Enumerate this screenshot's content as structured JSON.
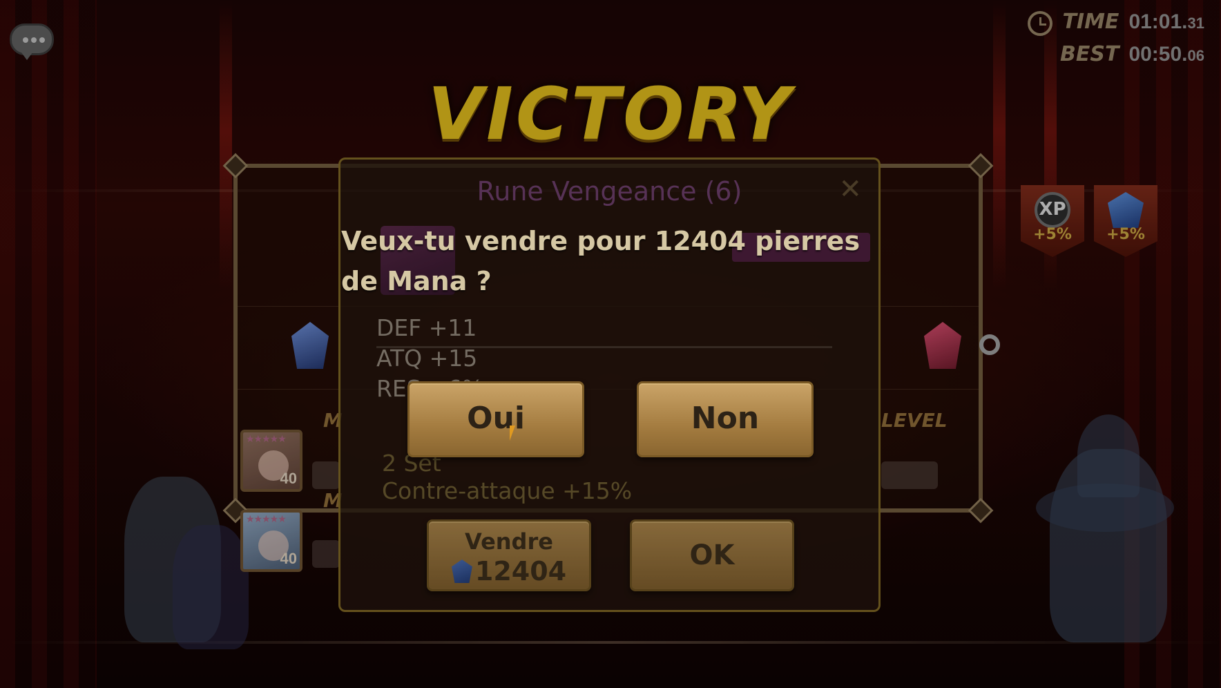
{
  "hud": {
    "time_label": "TIME",
    "time_main": "01:01.",
    "time_fraction": "31",
    "best_label": "BEST",
    "best_main": "00:50.",
    "best_fraction": "06"
  },
  "result": {
    "title": "VICTORY"
  },
  "buffs": [
    {
      "icon": "xp-emblem-icon",
      "label": "XP",
      "value": "+5%"
    },
    {
      "icon": "mana-crystal-icon",
      "value": "+5%"
    }
  ],
  "monsters": [
    {
      "level": "40",
      "stars": "★★★★★"
    },
    {
      "level": "40",
      "stars": "★★★★★"
    }
  ],
  "background_labels": {
    "left_m1": "M",
    "left_m2": "M",
    "level": "LEVEL"
  },
  "rune": {
    "title": "Rune Vengeance (6)",
    "close": "✕",
    "substats": [
      "DEF +11",
      "ATQ +15",
      "RES +6%"
    ],
    "set_label": "2 Set",
    "set_effect": "Contre-attaque +15%",
    "sell_label": "Vendre",
    "sell_amount": "12404",
    "ok_label": "OK"
  },
  "confirm": {
    "message": "Veux-tu vendre pour 12404 pierres de Mana ?",
    "yes_label": "Oui",
    "no_label": "Non"
  },
  "colors": {
    "victory_gold": "#d8b51c",
    "button_gold": "#a47c40",
    "rune_purple": "#6b3e6a"
  }
}
